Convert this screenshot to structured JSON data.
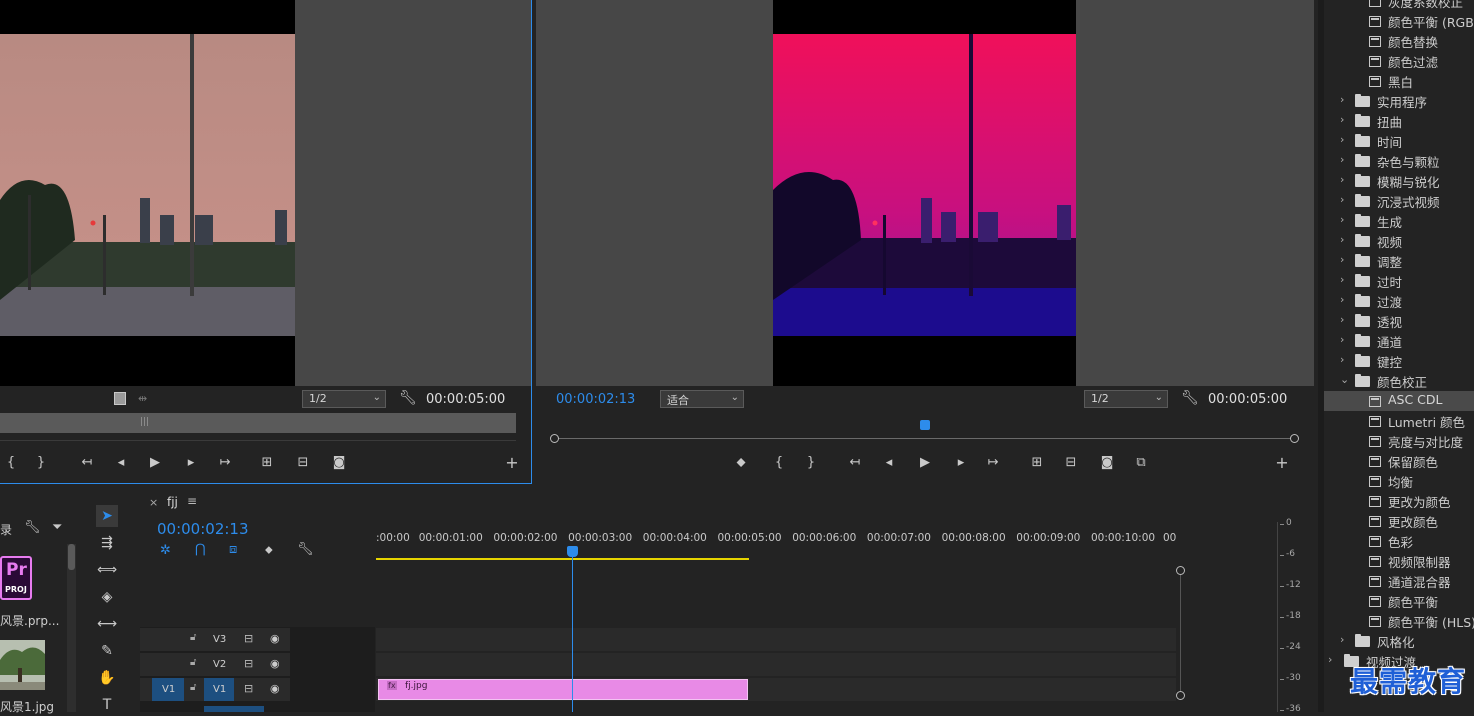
{
  "source_monitor": {
    "zoom": "1/2",
    "duration": "00:00:05:00"
  },
  "program_monitor": {
    "timecode": "00:00:02:13",
    "fit": "适合",
    "zoom": "1/2",
    "duration": "00:00:05:00"
  },
  "project_panel": {
    "tab_partial": "录",
    "items": [
      {
        "name": "风景.prp...",
        "icon": "premiere-project-icon",
        "badge": "Pr",
        "badge_sub": "PROJ"
      },
      {
        "name": "风景1.jpg",
        "icon": "image-thumbnail"
      }
    ]
  },
  "timeline": {
    "sequence_name": "fjj",
    "timecode": "00:00:02:13",
    "ruler_labels": [
      ":00:00",
      "00:00:01:00",
      "00:00:02:00",
      "00:00:03:00",
      "00:00:04:00",
      "00:00:05:00",
      "00:00:06:00",
      "00:00:07:00",
      "00:00:08:00",
      "00:00:09:00",
      "00:00:10:00",
      "00"
    ],
    "tracks": [
      {
        "name": "V3"
      },
      {
        "name": "V2"
      },
      {
        "name": "V1",
        "source_patch": "V1"
      }
    ],
    "clip": {
      "label": "fj.jpg",
      "badge": "fx",
      "color": "#e88ae6"
    },
    "playhead_fraction": 0.2457
  },
  "audio_meter": {
    "labels": [
      "0",
      "-6",
      "-12",
      "-18",
      "-24",
      "-30",
      "-36"
    ]
  },
  "effects_panel": {
    "items": [
      {
        "type": "effect",
        "label": "灰度系数校正"
      },
      {
        "type": "effect",
        "label": "颜色平衡 (RGB)"
      },
      {
        "type": "effect",
        "label": "颜色替换"
      },
      {
        "type": "effect",
        "label": "颜色过滤"
      },
      {
        "type": "effect",
        "label": "黑白"
      },
      {
        "type": "folder",
        "label": "实用程序",
        "expanded": false
      },
      {
        "type": "folder",
        "label": "扭曲",
        "expanded": false
      },
      {
        "type": "folder",
        "label": "时间",
        "expanded": false
      },
      {
        "type": "folder",
        "label": "杂色与颗粒",
        "expanded": false
      },
      {
        "type": "folder",
        "label": "模糊与锐化",
        "expanded": false
      },
      {
        "type": "folder",
        "label": "沉浸式视频",
        "expanded": false
      },
      {
        "type": "folder",
        "label": "生成",
        "expanded": false
      },
      {
        "type": "folder",
        "label": "视频",
        "expanded": false
      },
      {
        "type": "folder",
        "label": "调整",
        "expanded": false
      },
      {
        "type": "folder",
        "label": "过时",
        "expanded": false
      },
      {
        "type": "folder",
        "label": "过渡",
        "expanded": false
      },
      {
        "type": "folder",
        "label": "透视",
        "expanded": false
      },
      {
        "type": "folder",
        "label": "通道",
        "expanded": false
      },
      {
        "type": "folder",
        "label": "键控",
        "expanded": false
      },
      {
        "type": "folder",
        "label": "颜色校正",
        "expanded": true
      },
      {
        "type": "effect",
        "label": "ASC CDL",
        "selected": true
      },
      {
        "type": "effect",
        "label": "Lumetri 颜色"
      },
      {
        "type": "effect",
        "label": "亮度与对比度"
      },
      {
        "type": "effect",
        "label": "保留颜色"
      },
      {
        "type": "effect",
        "label": "均衡"
      },
      {
        "type": "effect",
        "label": "更改为颜色"
      },
      {
        "type": "effect",
        "label": "更改颜色"
      },
      {
        "type": "effect",
        "label": "色彩"
      },
      {
        "type": "effect",
        "label": "视频限制器"
      },
      {
        "type": "effect",
        "label": "通道混合器"
      },
      {
        "type": "effect",
        "label": "颜色平衡"
      },
      {
        "type": "effect",
        "label": "颜色平衡 (HLS)"
      },
      {
        "type": "folder",
        "label": "风格化",
        "expanded": false
      },
      {
        "type": "folder",
        "label": "视频过渡",
        "expanded": false,
        "root": true
      }
    ]
  },
  "watermark": "最需教育",
  "colors": {
    "accent_blue": "#2d8ceb",
    "clip_pink": "#e88ae6",
    "work_area_yellow": "#e6d400",
    "panel_bg": "#232323",
    "monitor_bg": "#474747"
  }
}
